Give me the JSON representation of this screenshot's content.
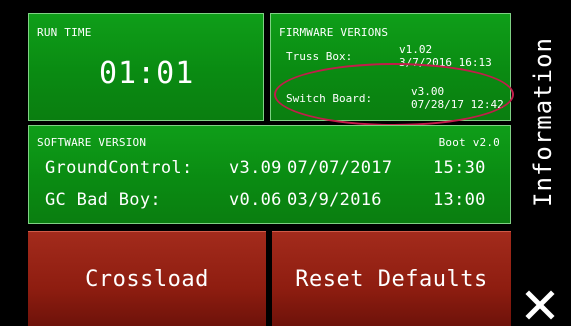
{
  "run_time": {
    "label": "RUN TIME",
    "value": "01:01"
  },
  "firmware": {
    "label": "FIRMWARE VERIONS",
    "truss_box": {
      "label": "Truss Box:",
      "version": "v1.02",
      "date": "3/7/2016 16:13"
    },
    "switch_board": {
      "label": "Switch Board:",
      "version": "v3.00",
      "date": "07/28/17 12:42"
    },
    "highlight_color": "#c21d4a"
  },
  "software": {
    "label": "SOFTWARE VERSION",
    "boot": "Boot v2.0",
    "rows": [
      {
        "name": "GroundControl:",
        "version": "v3.09",
        "date": "07/07/2017",
        "time": "15:30"
      },
      {
        "name": "GC Bad Boy:",
        "version": "v0.06",
        "date": "03/9/2016",
        "time": "13:00"
      }
    ]
  },
  "buttons": {
    "crossload": "Crossload",
    "reset": "Reset Defaults"
  },
  "side": {
    "title": "Information",
    "close_icon": "close-icon"
  },
  "colors": {
    "panel_green": "#0a8b12",
    "button_red": "#8e1d10",
    "background": "#000000"
  }
}
